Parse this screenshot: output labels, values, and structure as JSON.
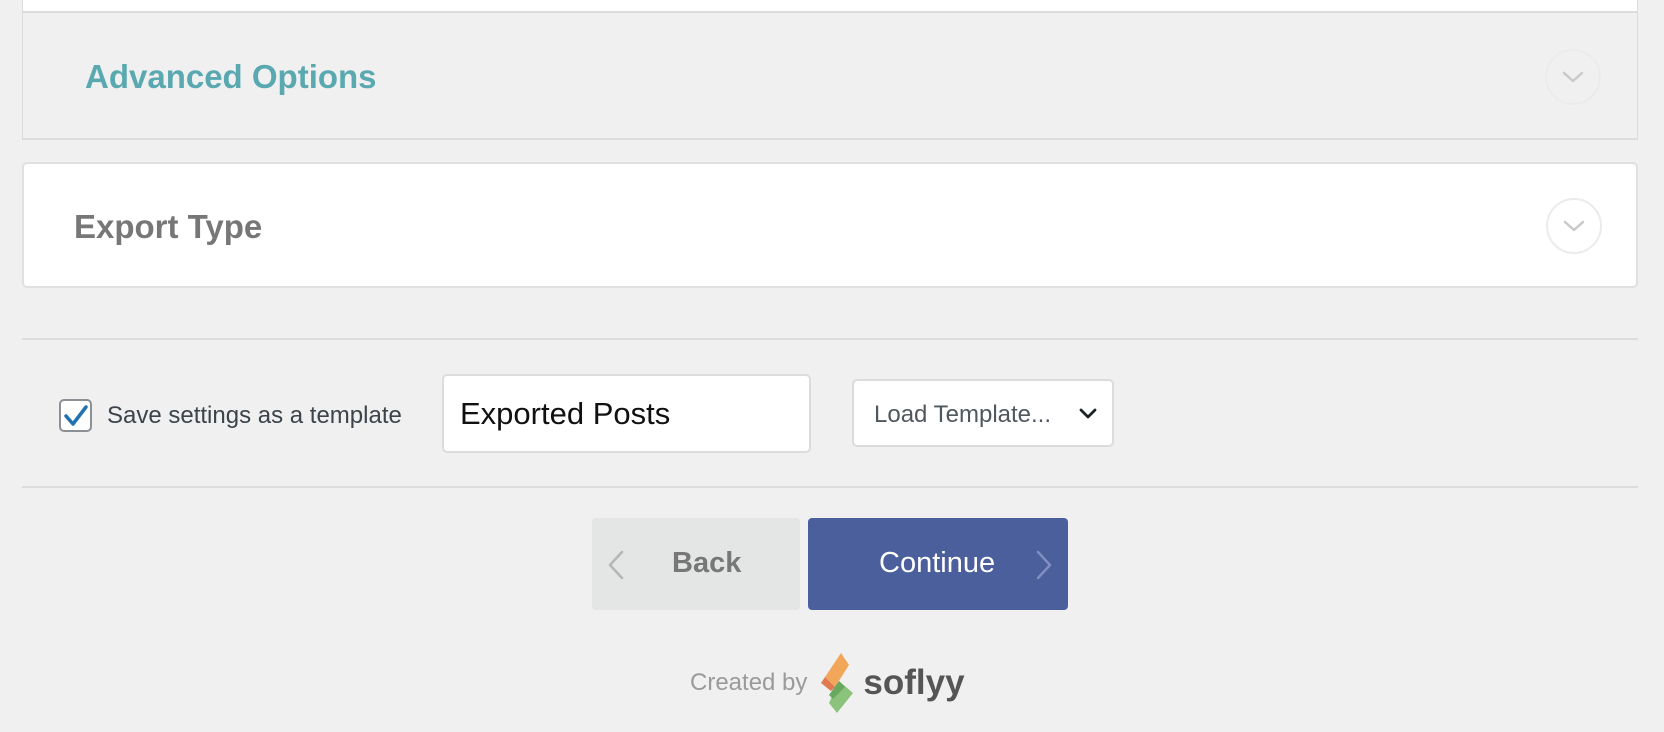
{
  "panels": {
    "advanced_options": {
      "title": "Advanced Options"
    },
    "export_type": {
      "title": "Export Type"
    }
  },
  "template": {
    "save_label": "Save settings as a template",
    "save_checked": true,
    "name_value": "Exported Posts",
    "load_select_label": "Load Template..."
  },
  "buttons": {
    "back_label": "Back",
    "continue_label": "Continue"
  },
  "footer": {
    "created_by": "Created by",
    "brand": "soflyy"
  },
  "icons": {
    "panel_toggle": "chevron-down-icon",
    "checkbox": "check-icon",
    "select": "chevron-down-icon",
    "back": "chevron-left-icon",
    "continue": "chevron-right-icon",
    "brand": "soflyy-logo"
  },
  "colors": {
    "accent_teal": "#5aa9b1",
    "primary_button": "#4a5f9c",
    "checkbox_check": "#2271b1"
  }
}
